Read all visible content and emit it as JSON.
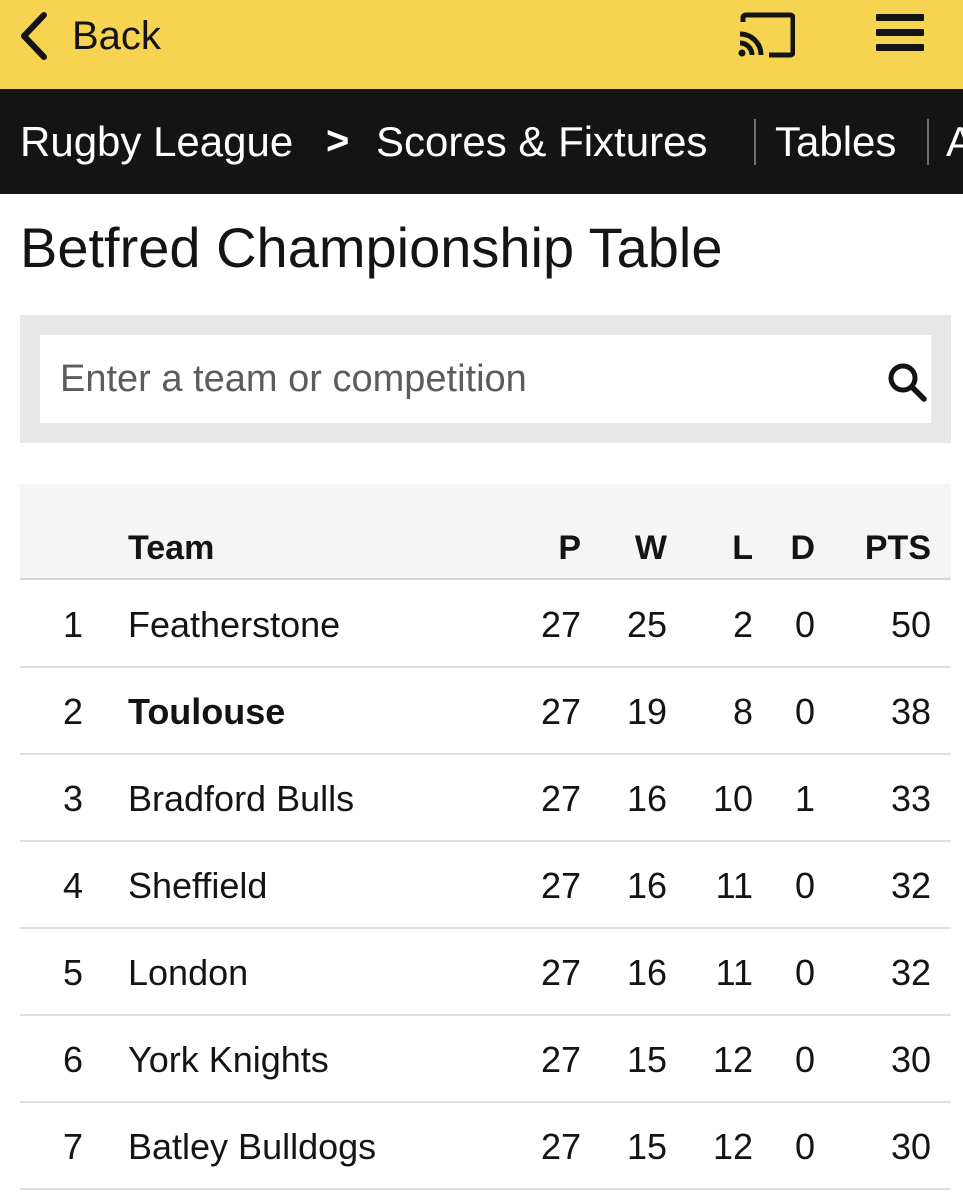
{
  "topbar": {
    "back_label": "Back",
    "icons": [
      "chevron-left-icon",
      "cast-icon",
      "hamburger-menu-icon"
    ],
    "background": "#f6d350"
  },
  "nav": {
    "section": "Rugby League",
    "items": [
      "Scores & Fixtures",
      "Tables",
      "A"
    ],
    "background": "#141414"
  },
  "page": {
    "title": "Betfred Championship Table"
  },
  "search": {
    "placeholder": "Enter a team or competition",
    "value": ""
  },
  "table": {
    "columns": [
      "Team",
      "P",
      "W",
      "L",
      "D",
      "PTS"
    ],
    "rows": [
      {
        "pos": "1",
        "team": "Featherstone",
        "p": "27",
        "w": "25",
        "l": "2",
        "d": "0",
        "pts": "50",
        "highlight": false
      },
      {
        "pos": "2",
        "team": "Toulouse",
        "p": "27",
        "w": "19",
        "l": "8",
        "d": "0",
        "pts": "38",
        "highlight": true
      },
      {
        "pos": "3",
        "team": "Bradford Bulls",
        "p": "27",
        "w": "16",
        "l": "10",
        "d": "1",
        "pts": "33",
        "highlight": false
      },
      {
        "pos": "4",
        "team": "Sheffield",
        "p": "27",
        "w": "16",
        "l": "11",
        "d": "0",
        "pts": "32",
        "highlight": false
      },
      {
        "pos": "5",
        "team": "London",
        "p": "27",
        "w": "16",
        "l": "11",
        "d": "0",
        "pts": "32",
        "highlight": false
      },
      {
        "pos": "6",
        "team": "York Knights",
        "p": "27",
        "w": "15",
        "l": "12",
        "d": "0",
        "pts": "30",
        "highlight": false
      },
      {
        "pos": "7",
        "team": "Batley Bulldogs",
        "p": "27",
        "w": "15",
        "l": "12",
        "d": "0",
        "pts": "30",
        "highlight": false
      }
    ]
  }
}
